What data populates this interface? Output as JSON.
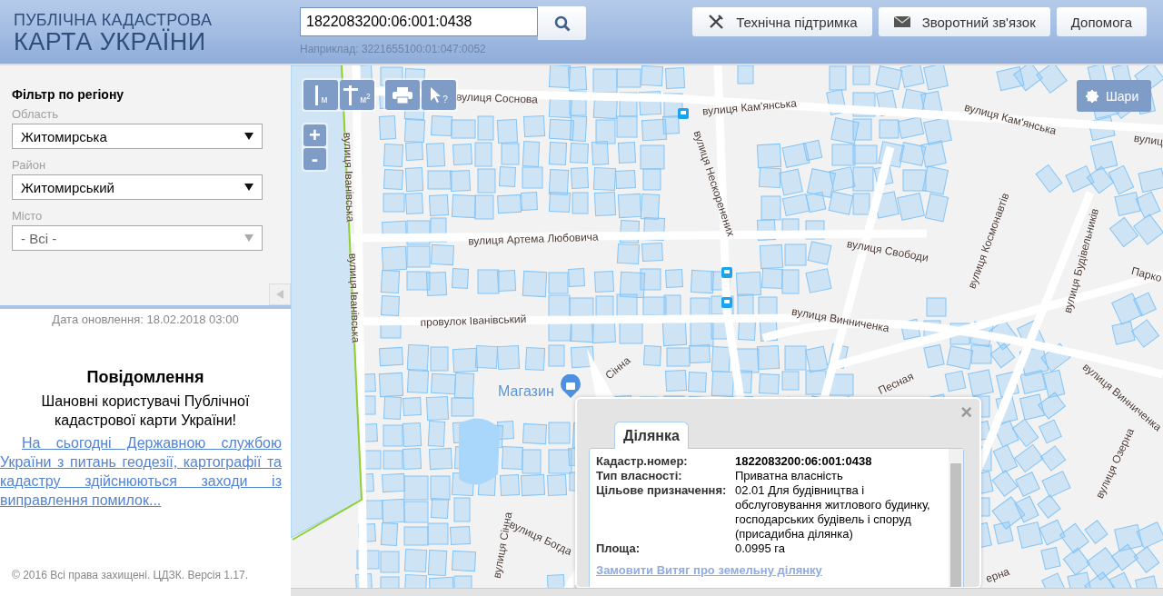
{
  "header": {
    "logo_top": "ПУБЛІЧНА КАДАСТРОВА",
    "logo_bottom": "КАРТА УКРАЇНИ",
    "search": {
      "value": "1822083200:06:001:0438",
      "hint": "Наприклад: 3221655100:01:047:0052"
    },
    "buttons": [
      {
        "kind": "support",
        "label": "Технічна підтримка"
      },
      {
        "kind": "feedback",
        "label": "Зворотний зв'язок"
      },
      {
        "kind": "help",
        "label": "Допомога"
      }
    ]
  },
  "sidebar": {
    "filter": {
      "title": "Фільтр по регіону",
      "fields": [
        {
          "label": "Область",
          "value": "Житомирська",
          "disabled": false
        },
        {
          "label": "Район",
          "value": "Житомирський",
          "disabled": false
        },
        {
          "label": "Місто",
          "value": "- Всі -",
          "disabled": true
        }
      ]
    },
    "update_date": "Дата оновлення: 18.02.2018 03:00",
    "notice": {
      "title": "Повідомлення",
      "greeting": "Шановні користувачі Публічної кадастрової карти України!",
      "link": "На сьогодні Державною службою України з питань геодезії, картографії та кадастру здійснюються заходи із виправлення помилок..."
    },
    "footer": "© 2016 Всі права захищені. ЦДЗК. Версія 1.17."
  },
  "map": {
    "tools": [
      {
        "kind": "distance",
        "label": "м"
      },
      {
        "kind": "area",
        "label": "м$^{2}$"
      },
      {
        "kind": "print"
      },
      {
        "kind": "identify",
        "label": "?"
      }
    ],
    "zoom": {
      "in": "+",
      "out": "-"
    },
    "layers_button": "Шари",
    "street_labels": [
      "вулиця Соснова",
      "вулиця Кам'янська",
      "вулиця Кам'янська",
      "вулиця Нескоренених",
      "вулиця Іванівська",
      "вулиця Іванівська",
      "вулиця Артема Любовича",
      "вулиця Свободи",
      "вулиця Космонавтів",
      "вулиця Будівельників",
      "Парко",
      "вулиця Винниченка",
      "провулок Іванівський",
      "Песная",
      "вулиця Винниченка",
      "вулиця Озерна",
      "вулиця Сінна",
      "вулиця Богда",
      "Сінна",
      "ерна",
      "вулиц"
    ],
    "poi": "Магазин",
    "popup": {
      "tabs": [
        {
          "label": "Ділянка",
          "selected": true
        }
      ],
      "close": "×",
      "rows": [
        {
          "label": "Кадастр.номер:",
          "value": "1822083200:06:001:0438"
        },
        {
          "label": "Тип власності:",
          "value": "Приватна власність"
        },
        {
          "label": "Цільове призначення:",
          "value": "02.01 Для будівництва і обслуговування житлового будинку, господарських будівель і споруд (присадибна ділянка)"
        },
        {
          "label": "Площа:",
          "value": "0.0995 га"
        }
      ],
      "link": "Замовити Витяг про земельну ділянку"
    }
  }
}
